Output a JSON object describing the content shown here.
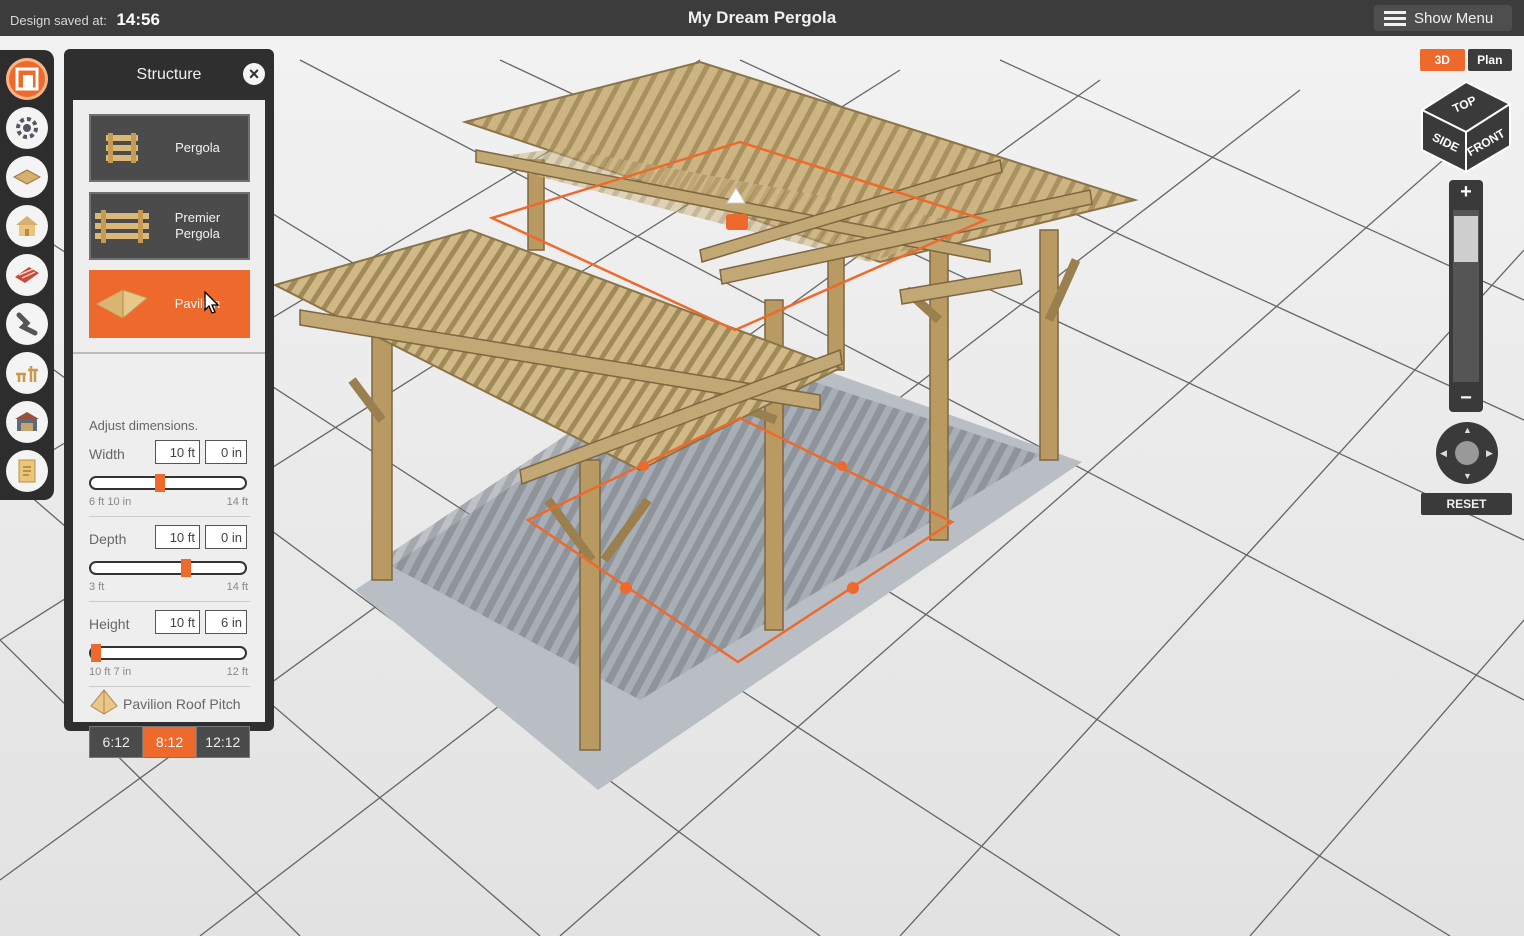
{
  "topbar": {
    "saved_label": "Design saved at:",
    "saved_time": "14:56",
    "title": "My Dream Pergola",
    "menu_label": "Show Menu"
  },
  "toolbar": {
    "tools": [
      {
        "name": "structure-icon",
        "active": true
      },
      {
        "name": "settings-icon",
        "active": false
      },
      {
        "name": "floor-icon",
        "active": false
      },
      {
        "name": "roof-icon",
        "active": false
      },
      {
        "name": "brick-icon",
        "active": false
      },
      {
        "name": "path-icon",
        "active": false
      },
      {
        "name": "furniture-icon",
        "active": false
      },
      {
        "name": "scene-icon",
        "active": false
      },
      {
        "name": "document-icon",
        "active": false
      }
    ]
  },
  "structure_panel": {
    "title": "Structure",
    "types": [
      {
        "label": "Pergola",
        "selected": false
      },
      {
        "label": "Premier Pergola",
        "selected": false
      },
      {
        "label": "Pavilion",
        "selected": true
      }
    ],
    "adjust_label": "Adjust dimensions.",
    "dimensions": [
      {
        "label": "Width",
        "ft": "10 ft",
        "in": "0 in",
        "min": "6 ft 10 in",
        "max": "14 ft",
        "level": 0.45
      },
      {
        "label": "Depth",
        "ft": "10 ft",
        "in": "0 in",
        "min": "3 ft",
        "max": "14 ft",
        "level": 0.62
      },
      {
        "label": "Height",
        "ft": "10 ft",
        "in": "6 in",
        "min": "10 ft 7 in",
        "max": "12 ft",
        "level": 0.03
      }
    ],
    "roof_pitch": {
      "label": "Pavilion Roof Pitch",
      "options": [
        "6:12",
        "8:12",
        "12:12"
      ],
      "selected": "8:12"
    }
  },
  "view_controls": {
    "mode_3d": "3D",
    "mode_plan": "Plan",
    "cube_faces": {
      "top": "TOP",
      "side": "SIDE",
      "front": "FRONT"
    },
    "zoom_in": "+",
    "zoom_out": "−",
    "reset_label": "RESET"
  },
  "colors": {
    "accent": "#ee6a2c",
    "chrome": "#3c3c3c",
    "wood": "#c8b07e"
  }
}
